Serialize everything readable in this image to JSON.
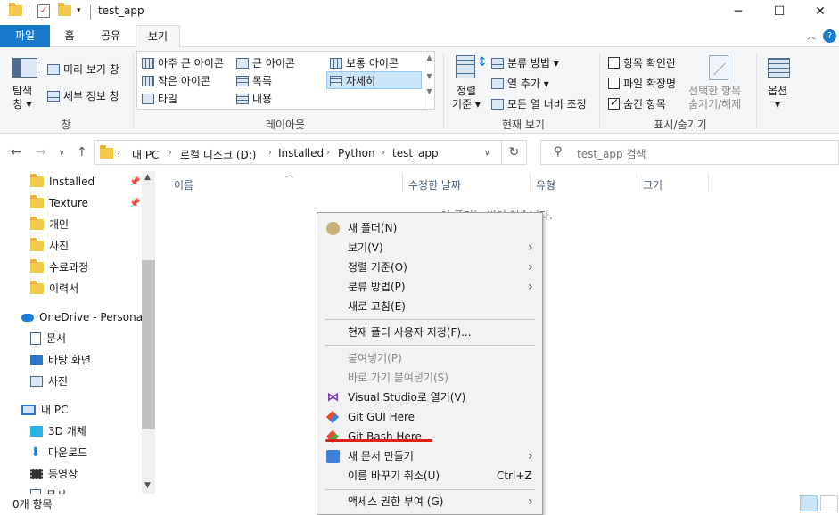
{
  "window": {
    "title": "test_app"
  },
  "ribbon_tabs": [
    "파일",
    "홈",
    "공유",
    "보기"
  ],
  "ribbon": {
    "pane": {
      "nav_pane_label": "탐색\n창",
      "nav_pane_1": "탐색",
      "nav_pane_2": "창 ▾",
      "preview": "미리 보기 창",
      "details": "세부 정보 창",
      "group": "창"
    },
    "layout": {
      "items": [
        "아주 큰 아이콘",
        "큰 아이콘",
        "보통 아이콘",
        "작은 아이콘",
        "목록",
        "자세히",
        "타일",
        "내용"
      ],
      "selected": "자세히",
      "group": "레이아웃"
    },
    "current_view": {
      "sort_1": "정렬",
      "sort_2": "기준 ▾",
      "group_by": "분류 방법 ▾",
      "add_column": "열 추가 ▾",
      "fit_columns": "모든 열 너비 조정",
      "group": "현재 보기"
    },
    "show_hide": {
      "item_checkboxes": "항목 확인란",
      "file_extensions": "파일 확장명",
      "hidden_items": "숨긴 항목",
      "hide_selected_1": "선택한 항목",
      "hide_selected_2": "숨기기/해제",
      "group": "표시/숨기기"
    },
    "options": {
      "label": "옵션",
      "arrow": "▾"
    }
  },
  "address": {
    "crumbs": [
      "내 PC",
      "로컬 디스크 (D:)",
      "Installed",
      "Python",
      "test_app"
    ],
    "search_placeholder": "test_app 검색"
  },
  "nav_pane": {
    "quick_access": [
      "Installed",
      "Texture",
      "개인",
      "사진",
      "수료과정",
      "이력서"
    ],
    "onedrive": "OneDrive - Personal",
    "onedrive_items": [
      "문서",
      "바탕 화면",
      "사진"
    ],
    "this_pc": "내 PC",
    "pc_items": [
      "3D 개체",
      "다운로드",
      "동영상",
      "문서"
    ]
  },
  "columns": {
    "name": "이름",
    "modified": "수정한 날짜",
    "type": "유형",
    "size": "크기"
  },
  "empty_message": "이 폴더는 비어 있습니다.",
  "status": {
    "count": "0개 항목"
  },
  "context_menu": {
    "new_folder": "새 폴더(N)",
    "view": "보기(V)",
    "sort": "정렬 기준(O)",
    "group": "분류 방법(P)",
    "refresh": "새로 고침(E)",
    "customize": "현재 폴더 사용자 지정(F)...",
    "paste": "붙여넣기(P)",
    "paste_shortcut": "바로 가기 붙여넣기(S)",
    "vs": "Visual Studio로 열기(V)",
    "git_gui": "Git GUI Here",
    "git_bash": "Git Bash Here",
    "new_doc": "새 문서 만들기",
    "undo": "이름 바꾸기 취소(U)",
    "undo_shortcut": "Ctrl+Z",
    "access": "액세스 권한 부여 (G)"
  },
  "colors": {
    "accent": "#1979ca",
    "highlight": "#e0201a"
  }
}
